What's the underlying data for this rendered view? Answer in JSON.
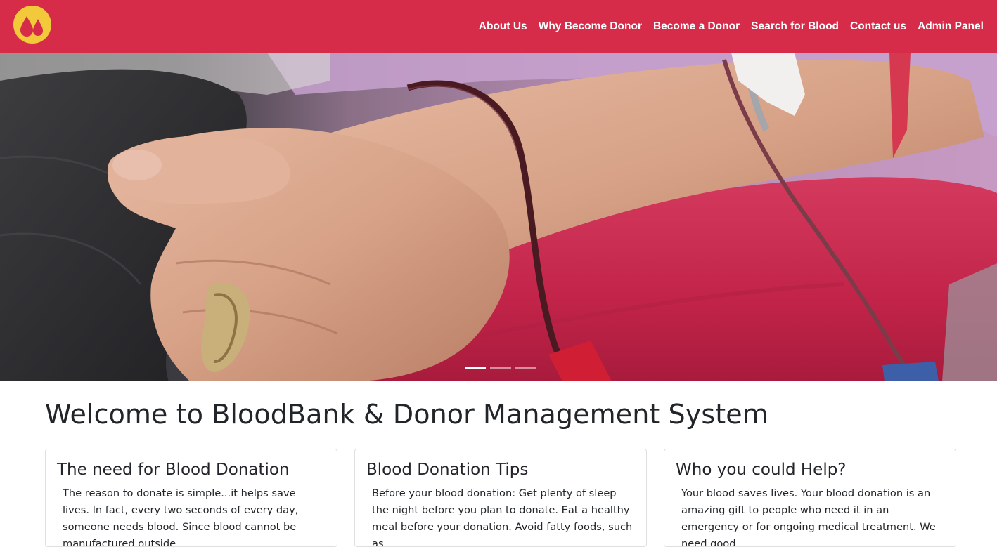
{
  "brand": {
    "logo_icon": "blood-drops-icon",
    "colors": {
      "navbar": "#d62c49",
      "logo_circle": "#f1c93a",
      "drop": "#d62c49"
    }
  },
  "nav": {
    "items": [
      {
        "label": "About Us"
      },
      {
        "label": "Why Become Donor"
      },
      {
        "label": "Become a Donor"
      },
      {
        "label": "Search for Blood"
      },
      {
        "label": "Contact us"
      },
      {
        "label": "Admin Panel"
      }
    ]
  },
  "carousel": {
    "slide_count": 3,
    "active_index": 0
  },
  "welcome": {
    "title": "Welcome to BloodBank & Donor Management System"
  },
  "cards": [
    {
      "title": "The need for Blood Donation",
      "text": "The reason to donate is simple...it helps save lives. In fact, every two seconds of every day, someone needs blood. Since blood cannot be manufactured outside"
    },
    {
      "title": "Blood Donation Tips",
      "text": "Before your blood donation: Get plenty of sleep the night before you plan to donate. Eat a healthy meal before your donation. Avoid fatty foods, such as"
    },
    {
      "title": "Who you could Help?",
      "text": "Your blood saves lives. Your blood donation is an amazing gift to people who need it in an emergency or for ongoing medical treatment. We need good"
    }
  ]
}
